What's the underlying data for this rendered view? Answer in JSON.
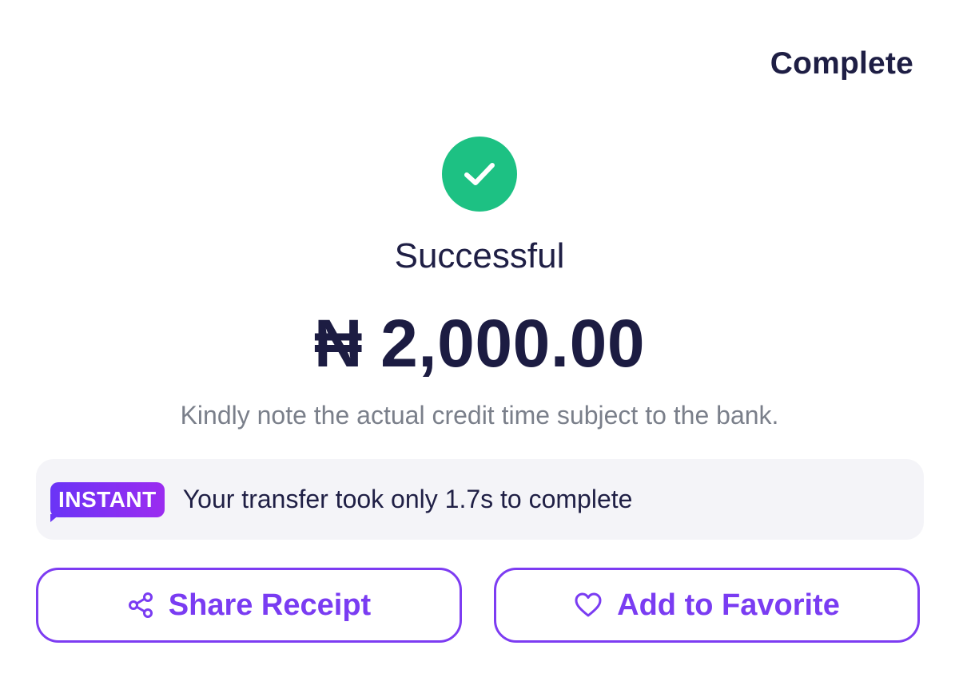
{
  "header": {
    "complete_label": "Complete"
  },
  "status": {
    "icon": "check-circle-icon",
    "title": "Successful",
    "color": "#1dc183"
  },
  "amount": {
    "currency_symbol": "₦",
    "value": "2,000.00"
  },
  "note": "Kindly note the actual credit time subject to the bank.",
  "instant": {
    "badge": "INSTANT",
    "message": "Your transfer took only 1.7s to complete"
  },
  "actions": {
    "share_label": "Share Receipt",
    "share_icon": "share-icon",
    "favorite_label": "Add to Favorite",
    "favorite_icon": "heart-icon"
  },
  "colors": {
    "accent": "#7a3cf2",
    "text": "#1f1f45",
    "muted": "#7a7f8a",
    "panel": "#f4f4f8"
  }
}
